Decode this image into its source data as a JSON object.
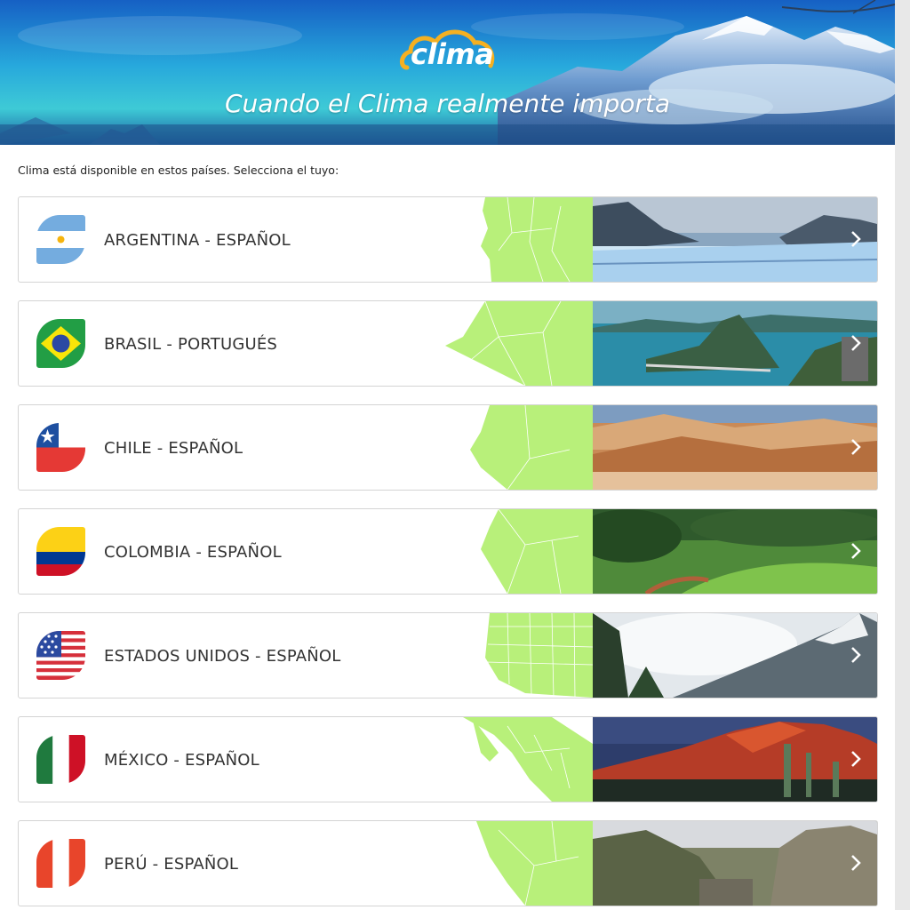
{
  "header": {
    "logo_text": "clima",
    "tagline": "Cuando el Clima realmente importa"
  },
  "intro_text": "Clima está disponible en estos países. Selecciona el tuyo:",
  "countries": [
    {
      "label": "ARGENTINA - ESPAÑOL",
      "flag": "argentina-flag",
      "photo": "glacier"
    },
    {
      "label": "BRASIL - PORTUGUÉS",
      "flag": "brazil-flag",
      "photo": "bay"
    },
    {
      "label": "CHILE - ESPAÑOL",
      "flag": "chile-flag",
      "photo": "desert"
    },
    {
      "label": "COLOMBIA - ESPAÑOL",
      "flag": "colombia-flag",
      "photo": "forest"
    },
    {
      "label": "ESTADOS UNIDOS - ESPAÑOL",
      "flag": "usa-flag",
      "photo": "mountain"
    },
    {
      "label": "MÉXICO - ESPAÑOL",
      "flag": "mexico-flag",
      "photo": "volcano"
    },
    {
      "label": "PERÚ - ESPAÑOL",
      "flag": "peru-flag",
      "photo": "ruins"
    }
  ],
  "colors": {
    "map_green": "#b8f07a",
    "card_border": "#d4d4d4",
    "text": "#333333"
  }
}
